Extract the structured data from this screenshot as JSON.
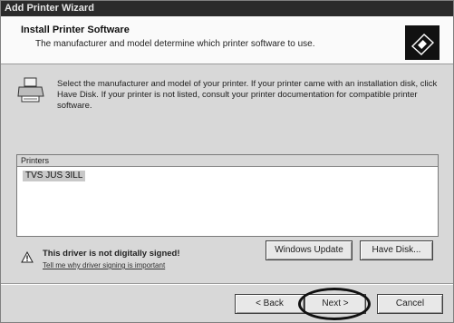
{
  "window": {
    "title": "Add Printer Wizard"
  },
  "header": {
    "title": "Install Printer Software",
    "subtitle": "The manufacturer and model determine which printer software to use.",
    "icon": "printer-disk-icon"
  },
  "intro": {
    "icon": "printer-icon",
    "text": "Select the manufacturer and model of your printer. If your printer came with an installation disk, click Have Disk. If your printer is not listed, consult your printer documentation for compatible printer software."
  },
  "printers_list": {
    "header": "Printers",
    "items": [
      "TVS JUS 3ILL"
    ],
    "selected_index": 0
  },
  "warning": {
    "icon": "warning-icon",
    "text": "This driver is not digitally signed!",
    "link": "Tell me why driver signing is important"
  },
  "buttons": {
    "windows_update": "Windows Update",
    "have_disk": "Have Disk...",
    "back": "< Back",
    "next": "Next >",
    "cancel": "Cancel"
  }
}
